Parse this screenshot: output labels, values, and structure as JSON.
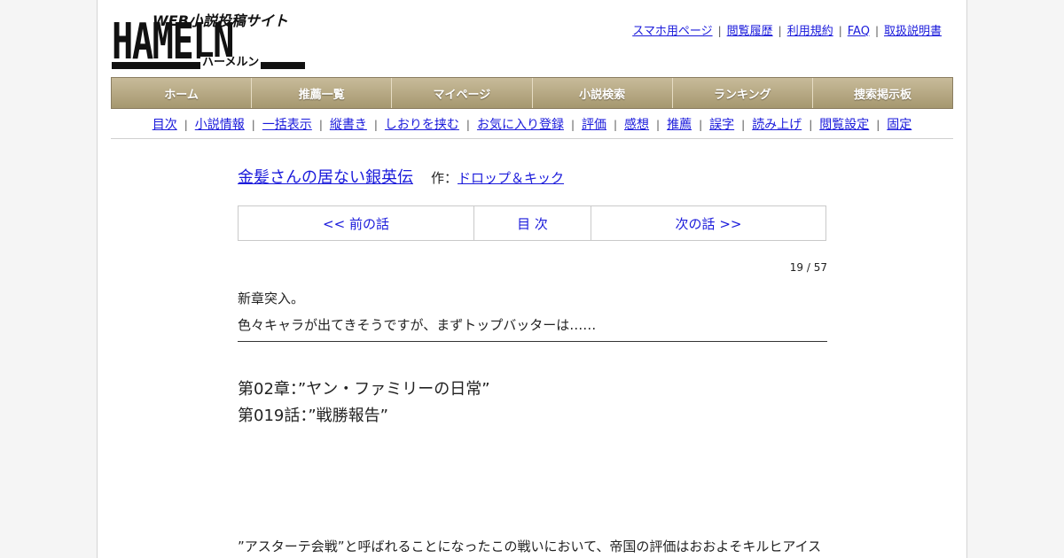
{
  "logo": {
    "tagline": "WEB小説投稿サイト",
    "wordmark": "HAMELN",
    "kana": "ハーメルン"
  },
  "toplinks": [
    "スマホ用ページ",
    "閲覧履歴",
    "利用規約",
    "FAQ",
    "取扱説明書"
  ],
  "mainnav": [
    "ホーム",
    "推薦一覧",
    "マイページ",
    "小説検索",
    "ランキング",
    "捜索掲示板"
  ],
  "subnav": [
    "目次",
    "小説情報",
    "一括表示",
    "縦書き",
    "しおりを挟む",
    "お気に入り登録",
    "評価",
    "感想",
    "推薦",
    "誤字",
    "読み上げ",
    "閲覧設定",
    "固定"
  ],
  "novel": {
    "title": "金髪さんの居ない銀英伝",
    "author_label": "作：",
    "author": "ドロップ＆キック"
  },
  "pager": {
    "prev": "<< 前の話",
    "toc": "目 次",
    "next": "次の話 >>"
  },
  "counter": "19 / 57",
  "preface": [
    "新章突入。",
    "色々キャラが出てきそうですが、まずトップバッターは……"
  ],
  "chapter": {
    "arc": "第02章：”ヤン・ファミリーの日常”",
    "episode": "第019話：”戦勝報告”"
  },
  "body_first_line": "”アスターテ会戦”と呼ばれることになったこの戦いにおいて、帝国の評価はおおよそキルヒアイス"
}
